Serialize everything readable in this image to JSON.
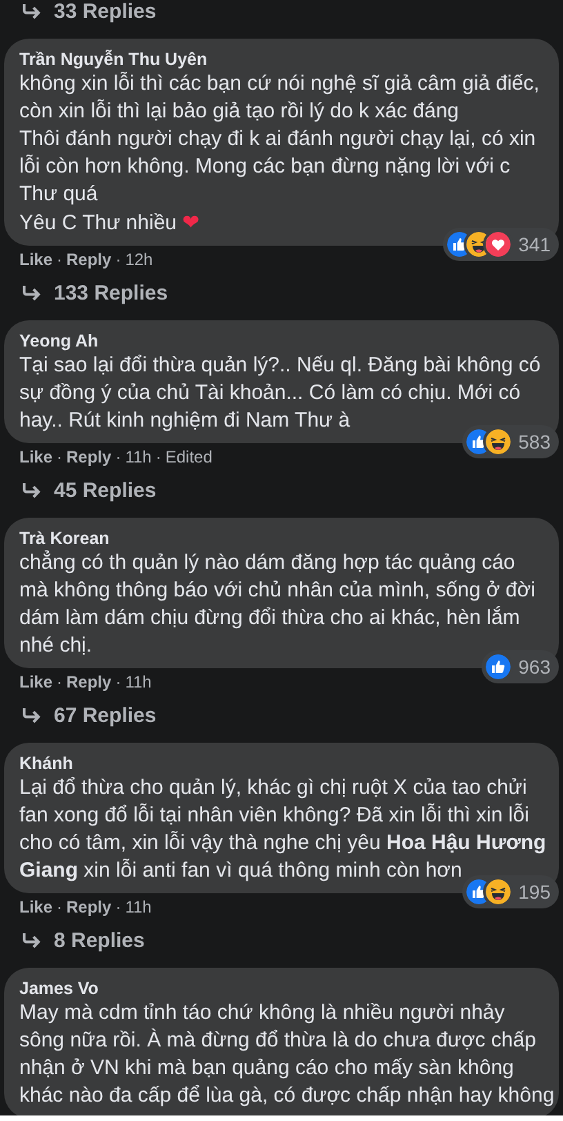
{
  "comments": [
    {
      "replies_before": "33 Replies",
      "author": "Trần Nguyễn Thu Uyên",
      "lines": [
        "không xin lỗi thì các bạn cứ nói nghệ sĩ giả câm giả điếc,",
        "còn xin lỗi thì lại bảo giả tạo rồi lý do k xác đáng",
        "Thôi đánh người chạy đi k ai đánh người chạy lại, có xin",
        "lỗi còn hơn không. Mong các bạn đừng nặng lời với c",
        "Thư quá",
        "Yêu C Thư nhiều"
      ],
      "trailing_emoji": "❤",
      "like": "Like",
      "separator": "·",
      "reply": "Reply",
      "time": "12h",
      "reactions": [
        {
          "kind": "like"
        },
        {
          "kind": "haha"
        },
        {
          "kind": "love"
        }
      ],
      "reaction_count": "341"
    },
    {
      "replies_before": "133 Replies",
      "author": "Yeong Ah",
      "lines": [
        "Tại sao lại đổi thừa quản lý?.. Nếu ql. Đăng bài không có",
        "sự đồng ý của chủ Tài khoản... Có làm có chịu. Mới có",
        "hay.. Rút kinh nghiệm đi Nam Thư à"
      ],
      "like": "Like",
      "separator": "·",
      "reply": "Reply",
      "time": "11h",
      "edited": "Edited",
      "reactions": [
        {
          "kind": "like"
        },
        {
          "kind": "haha"
        }
      ],
      "reaction_count": "583"
    },
    {
      "replies_before": "45 Replies",
      "author": "Trà Korean",
      "lines": [
        "chẳng có th quản lý nào dám đăng hợp tác quảng cáo",
        "mà không thông báo với chủ nhân của mình, sống ở đời",
        "dám làm dám chịu đừng đổi thừa cho ai khác, hèn lắm",
        "nhé chị."
      ],
      "like": "Like",
      "separator": "·",
      "reply": "Reply",
      "time": "11h",
      "reactions": [
        {
          "kind": "like"
        }
      ],
      "reaction_count": "963"
    },
    {
      "replies_before": "67 Replies",
      "author": "Khánh",
      "lines": [
        "Lại đổ thừa cho quản lý, khác gì chị ruột X của tao chửi",
        "fan xong đổ lỗi tại nhân viên không? Đã xin lỗi thì xin lỗi",
        "cho có tâm, xin lỗi vậy thà nghe chị yêu **Hoa Hậu Hương**",
        "**Giang** xin lỗi anti fan vì quá thông minh còn hơn"
      ],
      "like": "Like",
      "separator": "·",
      "reply": "Reply",
      "time": "11h",
      "reactions": [
        {
          "kind": "like"
        },
        {
          "kind": "haha"
        }
      ],
      "reaction_count": "195"
    },
    {
      "replies_before": "8 Replies",
      "author": "James Vo",
      "lines": [
        "May mà cdm tỉnh táo chứ không là nhiều người nhảy",
        "sông nữa rồi. À mà đừng đổ thừa là do chưa được chấp",
        "nhận ở VN khi mà bạn quảng cáo cho mấy sàn không",
        "khác nào đa cấp để lùa gà, có được chấp nhận hay không"
      ]
    }
  ]
}
